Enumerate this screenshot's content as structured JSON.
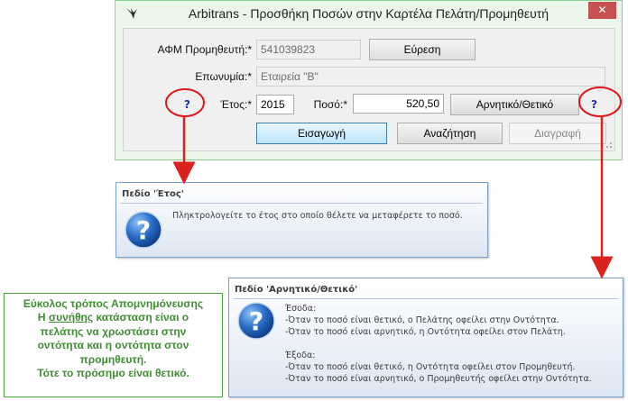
{
  "window": {
    "title": "Arbitrans - Προσθήκη Ποσών στην Καρτέλα Πελάτη/Προμηθευτή",
    "close_glyph": "✕"
  },
  "form": {
    "afm_label": "ΑΦΜ Προμηθευτή:*",
    "afm_value": "541039823",
    "find_button": "Εύρεση",
    "name_label": "Επωνυμία:*",
    "name_value": "Εταιρεία \"Β\"",
    "help_glyph": "?",
    "year_label": "Έτος:*",
    "year_value": "2015",
    "amount_label": "Ποσό:*",
    "amount_value": "520,50",
    "sign_button": "Αρνητικό/Θετικό",
    "insert_button": "Εισαγωγή",
    "search_button": "Αναζήτηση",
    "delete_button": "Διαγραφή"
  },
  "tip_year": {
    "title": "Πεδίο 'Έτος'",
    "text": "Πληκτρολογείτε το έτος στο οποίο θέλετε να μεταφέρετε το ποσό."
  },
  "tip_sign": {
    "title": "Πεδίο 'Αρνητικό/Θετικό'",
    "lines": [
      "Έσοδα:",
      "-Όταν το ποσό είναι θετικό, ο Πελάτης οφείλει στην Οντότητα.",
      "-Όταν το ποσό είναι αρνητικό, η Οντότητα οφείλει στον Πελάτη.",
      "Έξοδα:",
      "-Όταν το ποσό είναι θετικό, η Οντότητα οφείλει στον Προμηθευτή.",
      "-Όταν το ποσό είναι αρνητικό, ο Προμηθευτής οφείλει στην Οντότητα."
    ]
  },
  "note": {
    "line1": "Εύκολος τρόπος Απομνημόνευσης",
    "line2_pre": "Η ",
    "line2_u": "συνήθης",
    "line2_post": " κατάσταση είναι ο",
    "line3": "πελάτης να χρωστάσει στην",
    "line4": "οντότητα και η οντότητα στον",
    "line5": "προμηθευτή.",
    "line6": "Τότε το πρόσημο είναι θετικό."
  },
  "colors": {
    "help_ring": "#e0141a",
    "arrow": "#d9231c",
    "note_text": "#3e8e31",
    "help_q": "#1a2fb0"
  },
  "icons": {
    "app": "bird-logo-icon",
    "tip": "help-question-icon"
  }
}
